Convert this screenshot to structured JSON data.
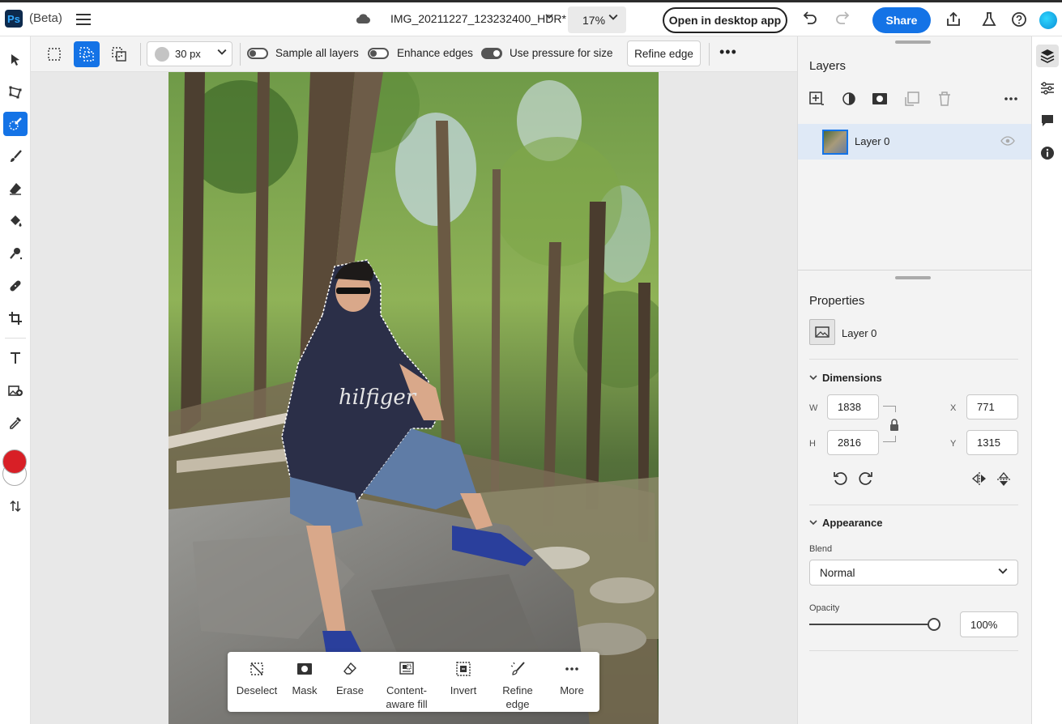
{
  "app": {
    "logo_text": "Ps",
    "beta_label": "(Beta)",
    "doc_title": "IMG_20211227_123232400_HDR*",
    "zoom": "17%",
    "open_desktop_label": "Open in desktop app",
    "share_label": "Share"
  },
  "options": {
    "brush_size": "30 px",
    "sample_all_layers_label": "Sample all layers",
    "sample_all_layers_on": false,
    "enhance_edges_label": "Enhance edges",
    "enhance_edges_on": false,
    "use_pressure_label": "Use pressure for size",
    "use_pressure_on": true,
    "refine_edge_label": "Refine edge"
  },
  "colors": {
    "foreground": "#d81f26",
    "background": "#ffffff",
    "accent": "#1473e6"
  },
  "taskbar": {
    "items": [
      {
        "label": "Deselect",
        "icon": "deselect-icon"
      },
      {
        "label": "Mask",
        "icon": "mask-icon"
      },
      {
        "label": "Erase",
        "icon": "eraser-icon"
      },
      {
        "label": "Content-",
        "label2": "aware fill",
        "icon": "content-aware-fill-icon"
      },
      {
        "label": "Invert",
        "icon": "invert-icon"
      },
      {
        "label": "Refine edge",
        "icon": "refine-edge-icon"
      },
      {
        "label": "More",
        "icon": "more-icon"
      }
    ]
  },
  "layers_panel": {
    "title": "Layers",
    "layers": [
      {
        "name": "Layer 0",
        "visible": true
      }
    ]
  },
  "properties_panel": {
    "title": "Properties",
    "layer_name": "Layer 0",
    "dimensions": {
      "title": "Dimensions",
      "w_label": "W",
      "h_label": "H",
      "x_label": "X",
      "y_label": "Y",
      "w": "1838",
      "h": "2816",
      "x": "771",
      "y": "1315"
    },
    "appearance": {
      "title": "Appearance",
      "blend_label": "Blend",
      "blend_value": "Normal",
      "opacity_label": "Opacity",
      "opacity_value": "100%",
      "opacity_fraction": 1.0
    }
  }
}
